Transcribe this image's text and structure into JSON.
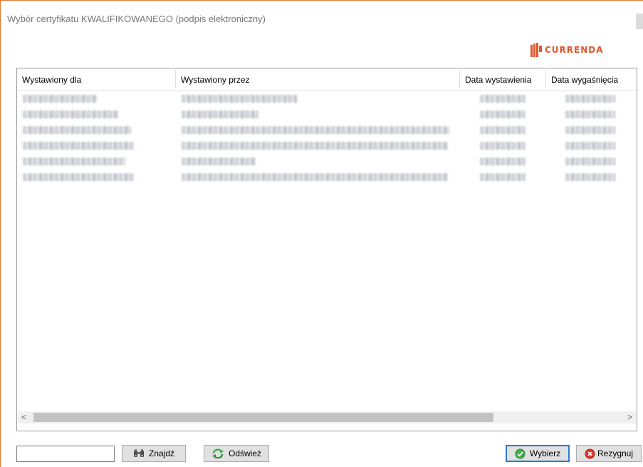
{
  "window": {
    "title": "Wybór certyfikatu KWALIFIKOWANEGO (podpis elektroniczny)"
  },
  "logo": {
    "text": "CURRENDA",
    "color": "#e0572b"
  },
  "table": {
    "columns": [
      "Wystawiony dla",
      "Wystawiony przez",
      "Data wystawienia",
      "Data wygaśnięcia"
    ]
  },
  "scrollbar": {
    "left_arrow": "<",
    "right_arrow": ">"
  },
  "footer": {
    "search_value": "",
    "find_label": "Znajdź",
    "refresh_label": "Odśwież",
    "select_label": "Wybierz",
    "cancel_label": "Rezygnuj"
  },
  "colors": {
    "accent_border": "#e07a2e",
    "primary_focus": "#2b7bd4",
    "ok_green": "#3fae49",
    "cancel_red": "#d9342b"
  },
  "icons": {
    "find": "binoculars-icon",
    "refresh": "refresh-arrows-icon",
    "select": "checkmark-circle-icon",
    "cancel": "close-circle-icon"
  }
}
